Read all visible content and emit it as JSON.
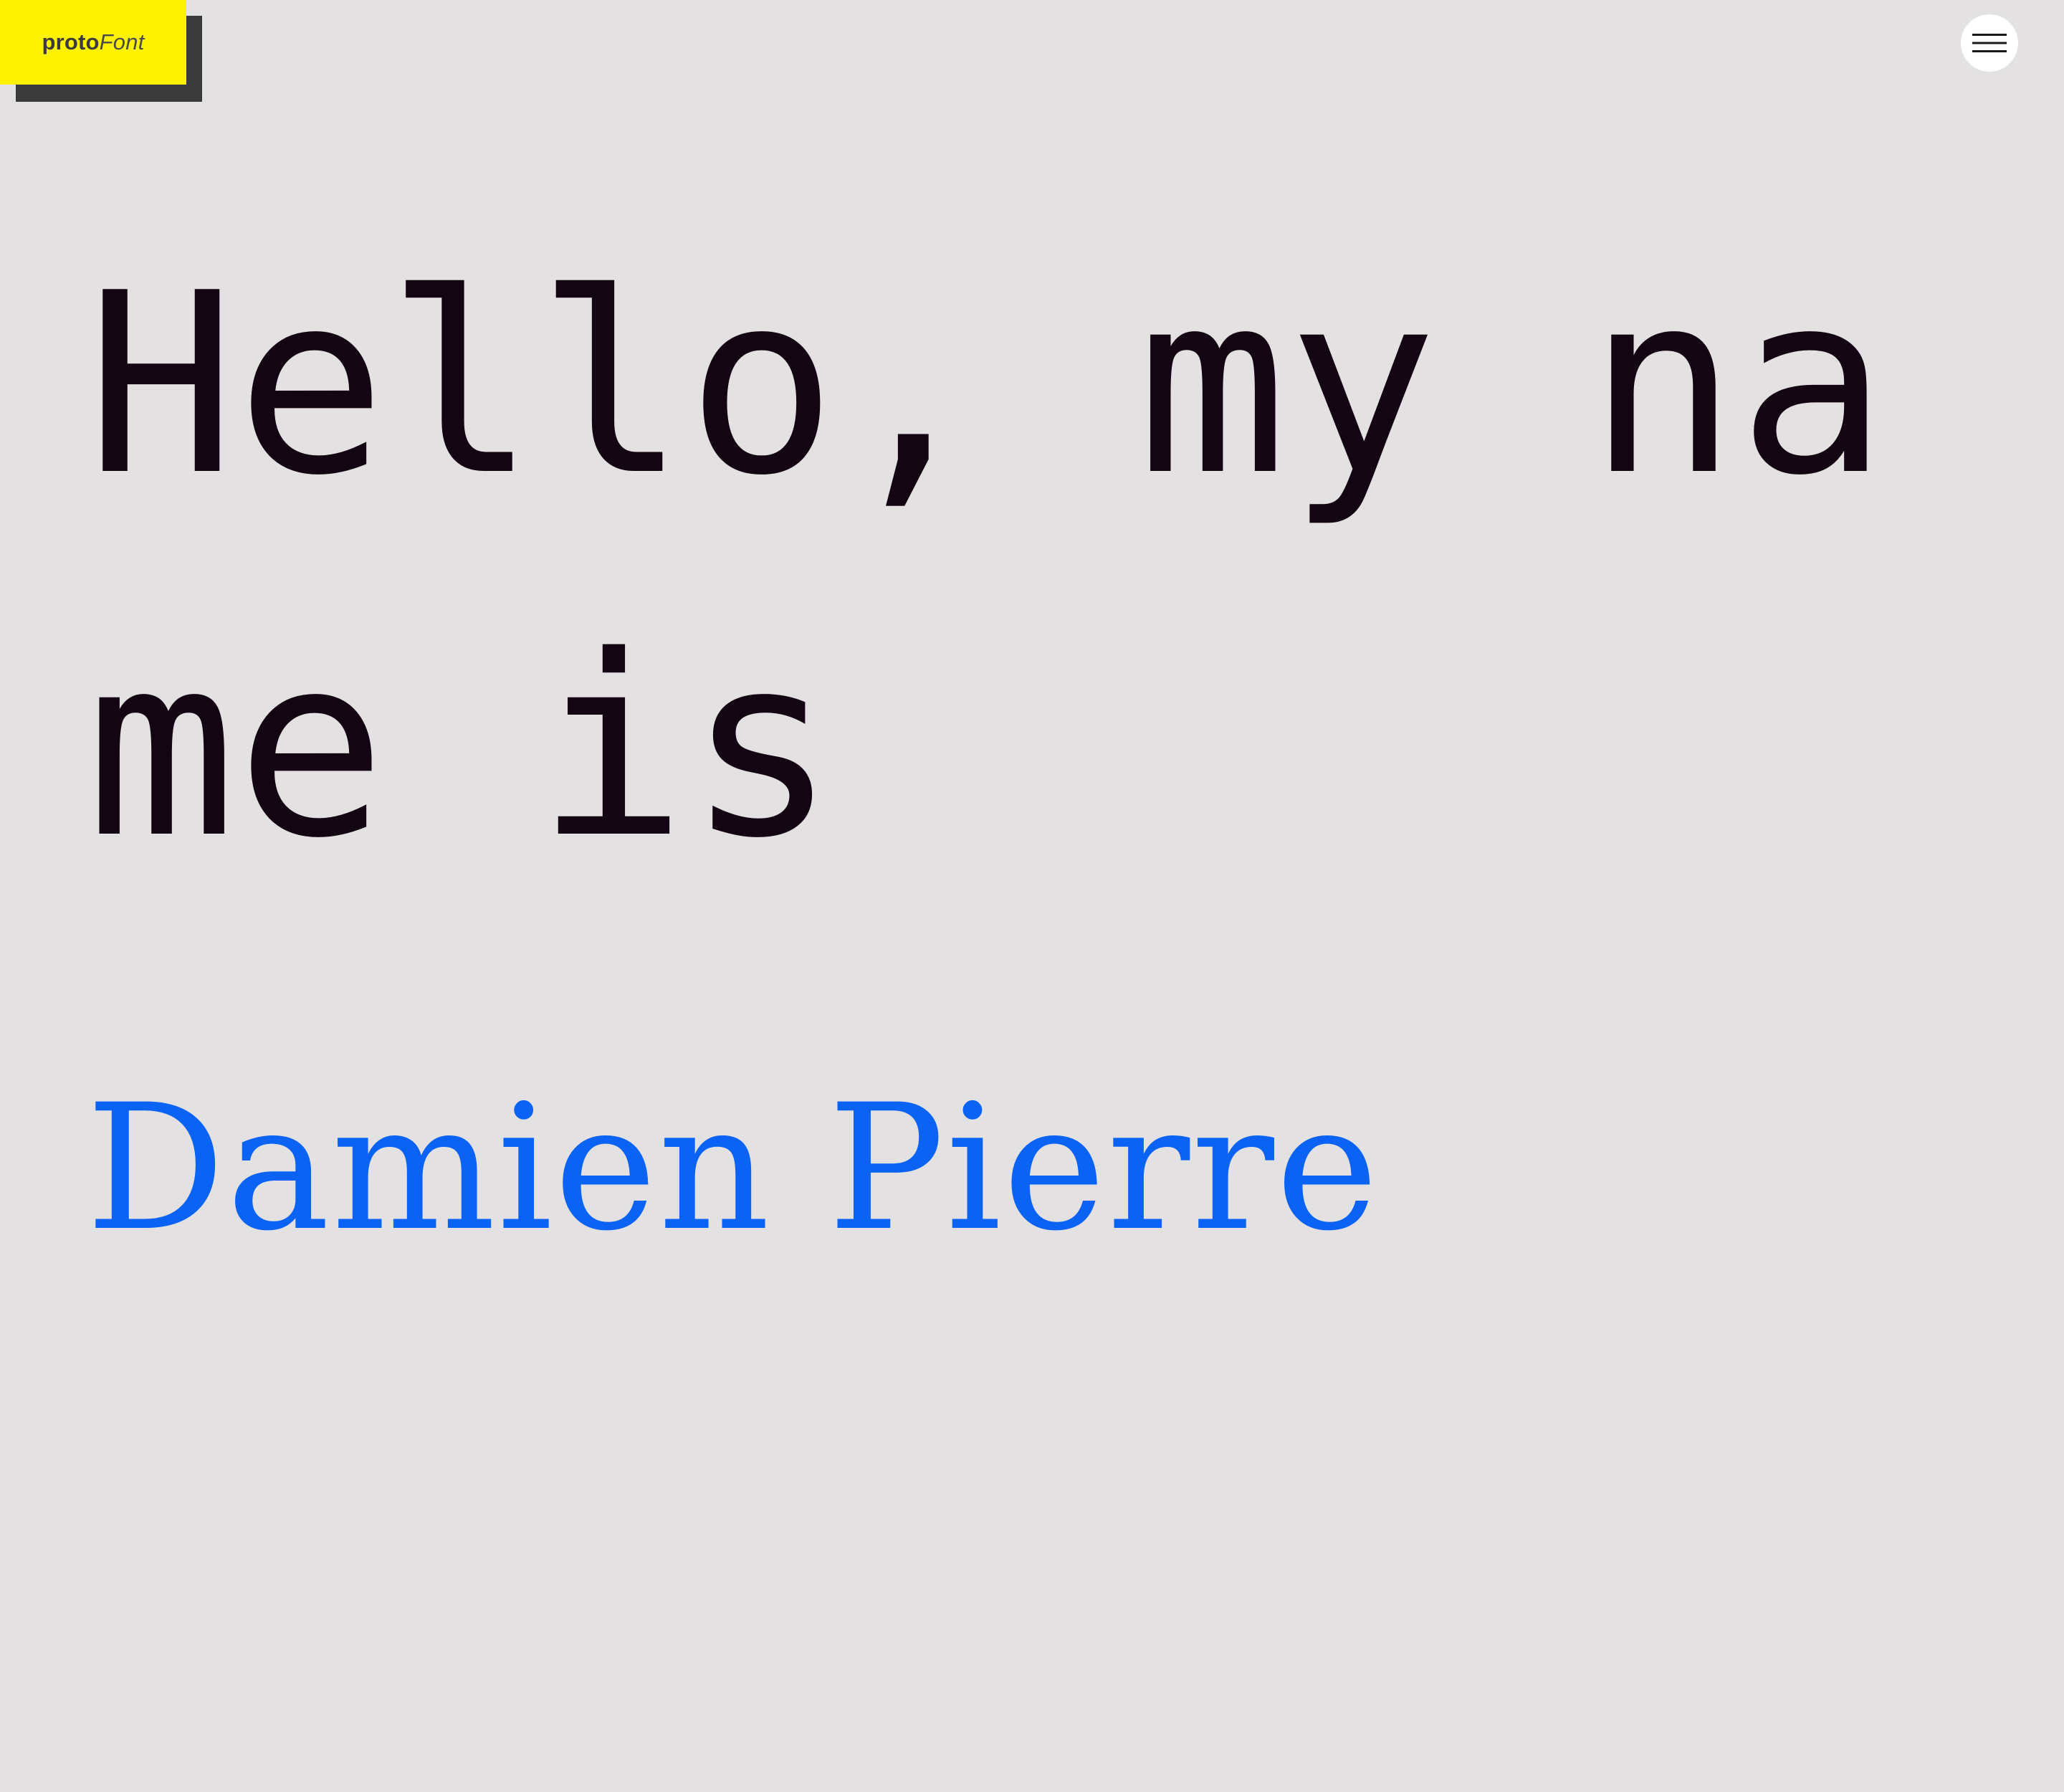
{
  "logo": {
    "bold": "proto",
    "italic": "Font"
  },
  "header": {
    "menu_icon": "hamburger-menu-icon"
  },
  "main": {
    "greeting": "Hello, my name is",
    "name": "Damien Pierre"
  },
  "colors": {
    "background": "#e3e1e2",
    "logo_yellow": "#fff200",
    "logo_shadow": "#3a3a3a",
    "text": "#140512",
    "accent": "#0b63f6"
  }
}
